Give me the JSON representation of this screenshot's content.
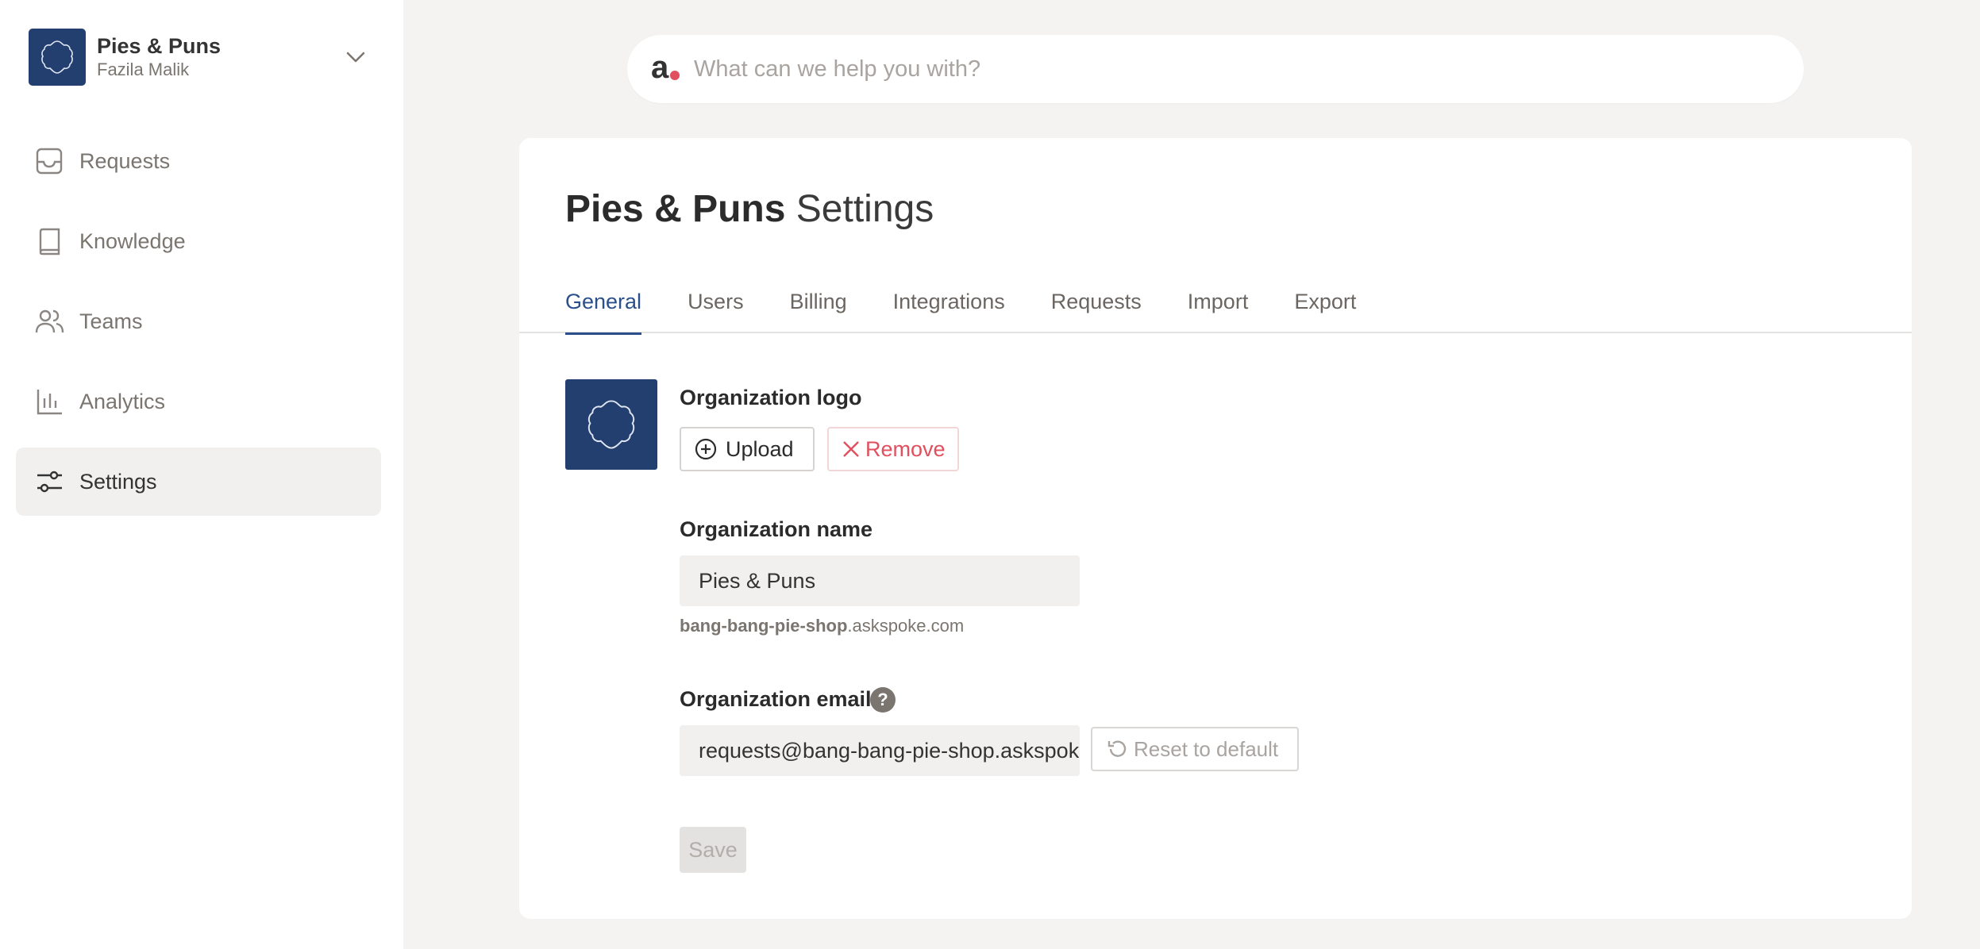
{
  "org": {
    "name": "Pies & Puns",
    "user": "Fazila Malik"
  },
  "nav": {
    "items": [
      {
        "label": "Requests",
        "icon": "inbox-icon"
      },
      {
        "label": "Knowledge",
        "icon": "book-icon"
      },
      {
        "label": "Teams",
        "icon": "users-icon"
      },
      {
        "label": "Analytics",
        "icon": "bar-chart-icon"
      },
      {
        "label": "Settings",
        "icon": "sliders-icon",
        "active": true
      }
    ]
  },
  "search": {
    "logo_letter": "a",
    "placeholder": "What can we help you with?"
  },
  "settings": {
    "title_org": "Pies & Puns",
    "title_suffix": "Settings",
    "tabs": [
      "General",
      "Users",
      "Billing",
      "Integrations",
      "Requests",
      "Import",
      "Export"
    ],
    "active_tab": "General",
    "logo": {
      "label": "Organization logo",
      "upload_label": "Upload",
      "remove_label": "Remove"
    },
    "name": {
      "label": "Organization name",
      "value": "Pies & Puns",
      "subdomain": "bang-bang-pie-shop",
      "domain_suffix": ".askspoke.com"
    },
    "email": {
      "label": "Organization email",
      "help": "?",
      "value": "requests@bang-bang-pie-shop.askspoke.com",
      "reset_label": "Reset to default"
    },
    "save_label": "Save"
  },
  "colors": {
    "brand": "#233f70",
    "accent": "#2a4f8a",
    "danger": "#e0505e"
  }
}
